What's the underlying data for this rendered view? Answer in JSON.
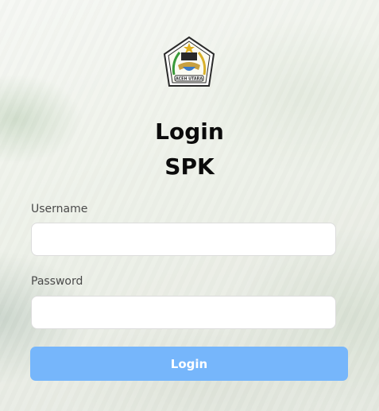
{
  "page": {
    "title_line1": "Login",
    "title_line2": "SPK"
  },
  "logo": {
    "icon": "aceh-utara-emblem-icon",
    "text": "ACEH UTARA"
  },
  "form": {
    "username_label": "Username",
    "username_value": "",
    "password_label": "Password",
    "password_value": "",
    "login_button": "Login"
  },
  "colors": {
    "button": "#76b6fb",
    "title": "#0b0b0b",
    "label": "#4a4a4a"
  }
}
